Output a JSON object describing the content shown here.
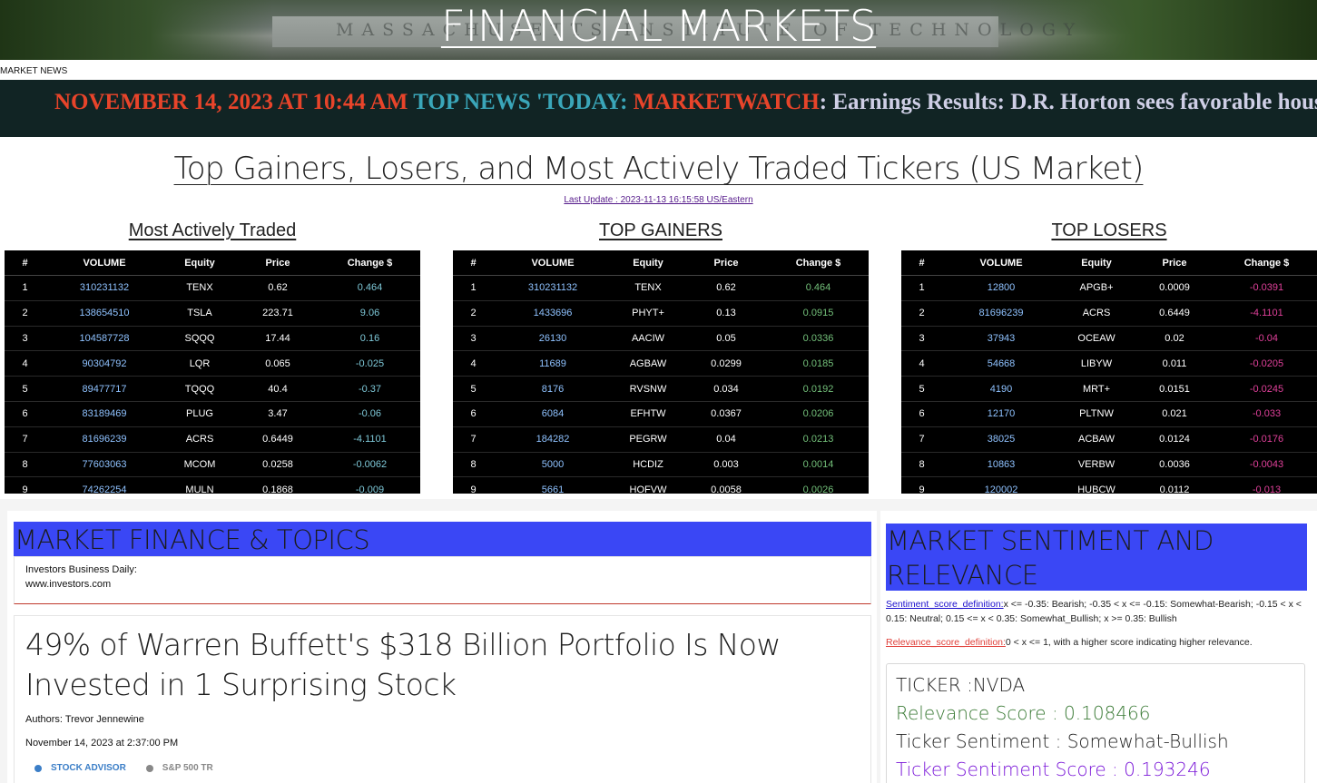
{
  "hero": {
    "title": "FINANCIAL MARKETS",
    "engraving": "MASSACHUSETTS INSTITUTE OF TECHNOLOGY"
  },
  "news": {
    "label": "MARKET NEWS",
    "date": "NOVEMBER 14, 2023 AT 10:44 AM",
    "top": "TOP NEWS 'TODAY:",
    "source": "MARKETWATCH",
    "headline": ": Earnings Results: D.R. Horton sees favorable housing d"
  },
  "movers": {
    "title": "Top Gainers, Losers, and Most Actively Traded Tickers (US Market)",
    "last_update": "Last Update : 2023-11-13 16:15:58 US/Eastern",
    "headers": [
      "#",
      "VOLUME",
      "Equity",
      "Price",
      "Change $"
    ],
    "active": {
      "title": "Most Actively Traded",
      "rows": [
        [
          "1",
          "310231132",
          "TENX",
          "0.62",
          "0.464"
        ],
        [
          "2",
          "138654510",
          "TSLA",
          "223.71",
          "9.06"
        ],
        [
          "3",
          "104587728",
          "SQQQ",
          "17.44",
          "0.16"
        ],
        [
          "4",
          "90304792",
          "LQR",
          "0.065",
          "-0.025"
        ],
        [
          "5",
          "89477717",
          "TQQQ",
          "40.4",
          "-0.37"
        ],
        [
          "6",
          "83189469",
          "PLUG",
          "3.47",
          "-0.06"
        ],
        [
          "7",
          "81696239",
          "ACRS",
          "0.6449",
          "-4.1101"
        ],
        [
          "8",
          "77603063",
          "MCOM",
          "0.0258",
          "-0.0062"
        ],
        [
          "9",
          "74262254",
          "MULN",
          "0.1868",
          "-0.009"
        ]
      ]
    },
    "gainers": {
      "title": "TOP GAINERS",
      "rows": [
        [
          "1",
          "310231132",
          "TENX",
          "0.62",
          "0.464"
        ],
        [
          "2",
          "1433696",
          "PHYT+",
          "0.13",
          "0.0915"
        ],
        [
          "3",
          "26130",
          "AACIW",
          "0.05",
          "0.0336"
        ],
        [
          "4",
          "11689",
          "AGBAW",
          "0.0299",
          "0.0185"
        ],
        [
          "5",
          "8176",
          "RVSNW",
          "0.034",
          "0.0192"
        ],
        [
          "6",
          "6084",
          "EFHTW",
          "0.0367",
          "0.0206"
        ],
        [
          "7",
          "184282",
          "PEGRW",
          "0.04",
          "0.0213"
        ],
        [
          "8",
          "5000",
          "HCDIZ",
          "0.003",
          "0.0014"
        ],
        [
          "9",
          "5661",
          "HOFVW",
          "0.0058",
          "0.0026"
        ]
      ]
    },
    "losers": {
      "title": "TOP LOSERS",
      "rows": [
        [
          "1",
          "12800",
          "APGB+",
          "0.0009",
          "-0.0391"
        ],
        [
          "2",
          "81696239",
          "ACRS",
          "0.6449",
          "-4.1101"
        ],
        [
          "3",
          "37943",
          "OCEAW",
          "0.02",
          "-0.04"
        ],
        [
          "4",
          "54668",
          "LIBYW",
          "0.011",
          "-0.0205"
        ],
        [
          "5",
          "4190",
          "MRT+",
          "0.0151",
          "-0.0245"
        ],
        [
          "6",
          "12170",
          "PLTNW",
          "0.021",
          "-0.033"
        ],
        [
          "7",
          "38025",
          "ACBAW",
          "0.0124",
          "-0.0176"
        ],
        [
          "8",
          "10863",
          "VERBW",
          "0.0036",
          "-0.0043"
        ],
        [
          "9",
          "120002",
          "HUBCW",
          "0.0112",
          "-0.013"
        ]
      ]
    }
  },
  "finance": {
    "title": "MARKET FINANCE & TOPICS",
    "source_name": "Investors Business Daily:",
    "source_url": "www.investors.com",
    "headline": "49% of Warren Buffett's $318 Billion Portfolio Is Now Invested in 1 Surprising Stock",
    "authors": "Authors: Trevor Jennewine",
    "date": "November 14, 2023 at 2:37:00 PM",
    "legend": [
      "STOCK ADVISOR",
      "S&P 500 TR"
    ],
    "legend_colors": [
      "#3b7ec7",
      "#888888"
    ]
  },
  "sentiment": {
    "title": "MARKET SENTIMENT AND RELEVANCE",
    "sentiment_def_link": "Sentiment_score_definition:",
    "sentiment_def_text": "x <= -0.35: Bearish; -0.35 < x <= -0.15: Somewhat-Bearish; -0.15 < x < 0.15: Neutral; 0.15 <= x < 0.35: Somewhat_Bullish; x >= 0.35: Bullish",
    "relevance_def_link": "Relevance_score_definition:",
    "relevance_def_text": "0 < x <= 1, with a higher score indicating higher relevance.",
    "ticker": "TICKER :NVDA",
    "relevance": "Relevance Score : 0.108466",
    "ticker_sentiment": "Ticker Sentiment : Somewhat-Bullish",
    "ticker_score": "Ticker Sentiment Score : 0.193246"
  }
}
